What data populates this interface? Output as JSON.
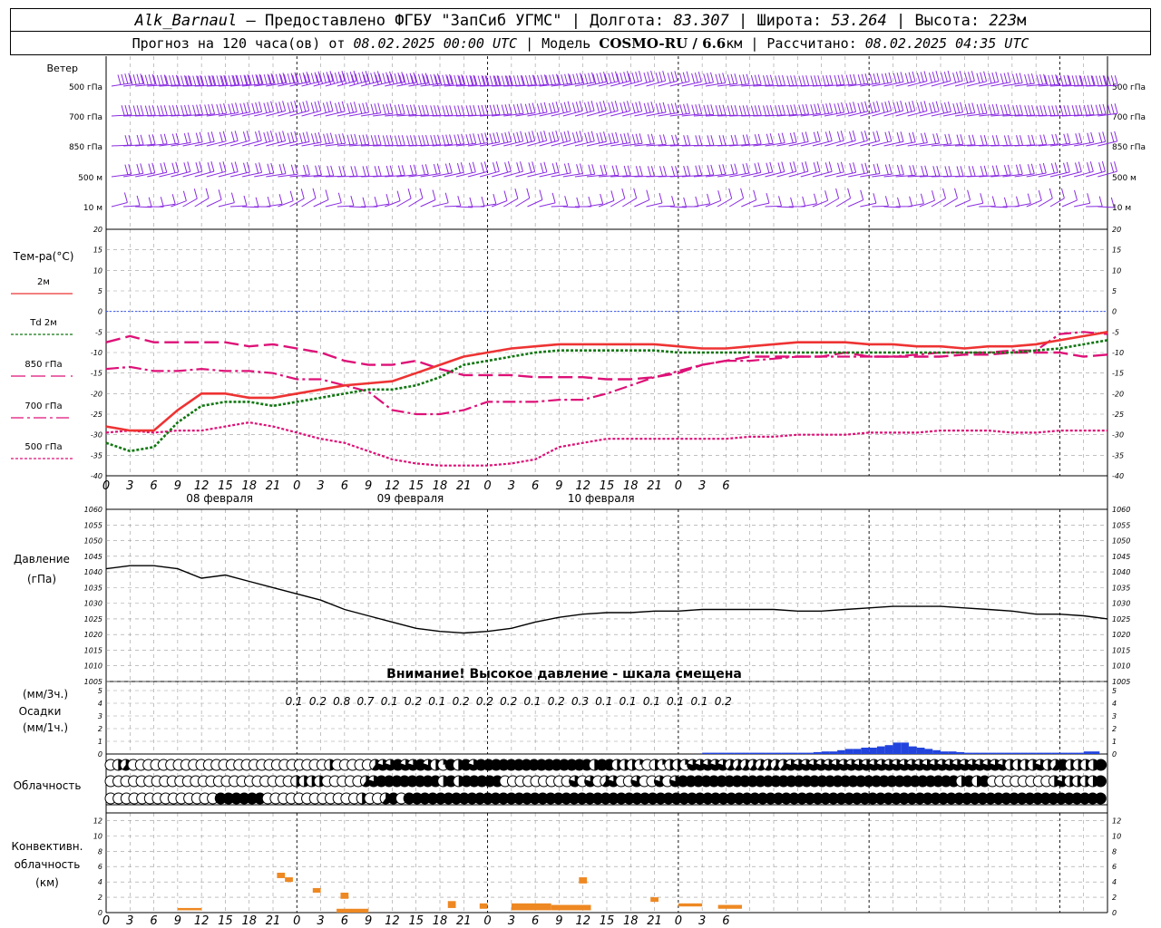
{
  "header": {
    "station": "Alk_Barnaul",
    "provider": " — Предоставлено ФГБУ \"ЗапСиб УГМС\" | Долгота: ",
    "lon": "83.307",
    "lat_label": " | Широта: ",
    "lat": "53.264",
    "alt_label": " | Высота: ",
    "alt": "223",
    "alt_unit": "м",
    "forecast_label": "Прогноз на 120 часа(ов) от ",
    "forecast_start": "08.02.2025 00:00 UTC",
    "model_label": " | Модель ",
    "model": "COSMO-RU / 6.6",
    "model_unit": "км",
    "calc_label": " | Рассчитано: ",
    "calc_time": "08.02.2025 04:35 UTC"
  },
  "labels": {
    "wind_title": "Ветер",
    "temp_title": "Тем-ра(°C)",
    "pressure_title": "Давление",
    "pressure_unit": "(гПа)",
    "pressure_warning": "Внимание! Высокое давление - шкала смещена",
    "precip_3h": "(мм/3ч.)",
    "precip_title": "Осадки",
    "precip_1h": "(мм/1ч.)",
    "cloud_title": "Облачность",
    "conv_line1": "Конвективн.",
    "conv_line2": "облачность",
    "conv_line3": "(км)"
  },
  "colors": {
    "wind": "#8a2be2",
    "t2m": "#ee3333",
    "td2m": "#117711",
    "t850": "#dd1177",
    "t700": "#dd1177",
    "t500": "#dd1177",
    "pressure": "#000000",
    "precip": "#2244dd",
    "conv": "#ee8822",
    "zero": "#3355ff"
  },
  "chart_data": {
    "type": "meteogram",
    "hours_total": 126,
    "x_ticks": [
      "0",
      "3",
      "6",
      "9",
      "12",
      "15",
      "18",
      "21",
      "0",
      "3",
      "6",
      "9",
      "12",
      "15",
      "18",
      "21",
      "0",
      "3",
      "6",
      "9",
      "12",
      "15",
      "18",
      "21",
      "0",
      "3",
      "6"
    ],
    "day_labels": [
      "08 февраля",
      "09 февраля",
      "10 февраля"
    ],
    "wind": {
      "levels": [
        "500 гПа",
        "700 гПа",
        "850 гПа",
        "500 м",
        "10 м"
      ]
    },
    "temperature": {
      "y_ticks": [
        20,
        15,
        10,
        5,
        0,
        -5,
        -10,
        -15,
        -20,
        -25,
        -30,
        -35,
        -40
      ],
      "ylim": [
        -40,
        20
      ],
      "legend": [
        "2м",
        "Td 2м",
        "850 гПа",
        "700 гПа",
        "500 гПа"
      ],
      "hours": [
        0,
        3,
        6,
        9,
        12,
        15,
        18,
        21,
        24,
        27,
        30,
        33,
        36,
        39,
        42,
        45,
        48,
        51,
        54,
        57,
        60,
        63,
        66,
        69,
        72,
        75,
        78,
        81,
        84,
        87,
        90,
        93,
        96,
        99,
        102,
        105,
        108,
        111,
        114,
        117,
        120,
        123,
        126
      ],
      "t2m": [
        -28,
        -29,
        -29,
        -24,
        -20,
        -20,
        -21,
        -21,
        -20,
        -19,
        -18,
        -17.5,
        -17,
        -15,
        -13,
        -11,
        -10,
        -9,
        -8.5,
        -8,
        -8,
        -8,
        -8,
        -8,
        -8.5,
        -9,
        -9,
        -8.5,
        -8,
        -7.5,
        -7.5,
        -7.5,
        -8,
        -8,
        -8.5,
        -8.5,
        -9,
        -8.5,
        -8.5,
        -8,
        -7,
        -6,
        -5
      ],
      "td2m": [
        -32,
        -34,
        -33,
        -27,
        -23,
        -22,
        -22,
        -23,
        -22,
        -21,
        -20,
        -19,
        -19,
        -18,
        -16,
        -13,
        -12,
        -11,
        -10,
        -9.5,
        -9.5,
        -9.5,
        -9.5,
        -9.5,
        -10,
        -10,
        -10,
        -10,
        -10,
        -10,
        -10,
        -10,
        -10,
        -10,
        -10,
        -10,
        -10,
        -10,
        -10,
        -9.5,
        -9,
        -8,
        -7
      ],
      "t850": [
        -7.5,
        -6,
        -7.5,
        -7.5,
        -7.5,
        -7.5,
        -8.5,
        -8,
        -9,
        -10,
        -12,
        -13,
        -13,
        -12,
        -14,
        -15.5,
        -15.5,
        -15.5,
        -16,
        -16,
        -16,
        -16.5,
        -16.5,
        -16,
        -15,
        -13,
        -12,
        -11,
        -11,
        -11,
        -11,
        -10,
        -11,
        -11,
        -11,
        -11,
        -10.5,
        -10.5,
        -10,
        -10,
        -10,
        -11,
        -10.5
      ],
      "t700": [
        -14,
        -13.5,
        -14.5,
        -14.5,
        -14,
        -14.5,
        -14.5,
        -15,
        -16.5,
        -16.5,
        -18,
        -19.5,
        -24,
        -25,
        -25,
        -24,
        -22,
        -22,
        -22,
        -21.5,
        -21.5,
        -20,
        -18,
        -16,
        -14.5,
        -13,
        -12,
        -12,
        -11.5,
        -11,
        -11,
        -11,
        -11,
        -11,
        -10.5,
        -10,
        -10,
        -10,
        -9.5,
        -9.5,
        -5.5,
        -5,
        -5.5
      ],
      "t500": [
        -29.5,
        -29,
        -29.5,
        -29,
        -29,
        -28,
        -27,
        -28,
        -29.5,
        -31,
        -32,
        -34,
        -36,
        -37,
        -37.5,
        -37.5,
        -37.5,
        -37,
        -36,
        -33,
        -32,
        -31,
        -31,
        -31,
        -31,
        -31,
        -31,
        -30.5,
        -30.5,
        -30,
        -30,
        -30,
        -29.5,
        -29.5,
        -29.5,
        -29,
        -29,
        -29,
        -29.5,
        -29.5,
        -29,
        -29,
        -29
      ]
    },
    "pressure": {
      "y_ticks": [
        1060,
        1055,
        1050,
        1045,
        1040,
        1035,
        1030,
        1025,
        1020,
        1015,
        1010,
        1005
      ],
      "ylim": [
        1005,
        1060
      ],
      "hours": [
        0,
        3,
        6,
        9,
        12,
        15,
        18,
        21,
        24,
        27,
        30,
        33,
        36,
        39,
        42,
        45,
        48,
        51,
        54,
        57,
        60,
        63,
        66,
        69,
        72,
        75,
        78,
        81,
        84,
        87,
        90,
        93,
        96,
        99,
        102,
        105,
        108,
        111,
        114,
        117,
        120,
        123,
        126
      ],
      "values": [
        1041,
        1042,
        1042,
        1041,
        1038,
        1039,
        1037,
        1035,
        1033,
        1031,
        1028,
        1026,
        1024,
        1022,
        1021,
        1020.5,
        1021,
        1022,
        1024,
        1025.5,
        1026.5,
        1027,
        1027,
        1027.5,
        1027.5,
        1028,
        1028,
        1028,
        1028,
        1027.5,
        1027.5,
        1028,
        1028.5,
        1029,
        1029,
        1029,
        1028.5,
        1028,
        1027.5,
        1026.5,
        1026.5,
        1026,
        1025
      ]
    },
    "precipitation": {
      "y_ticks": [
        5,
        4,
        3,
        2,
        1,
        0
      ],
      "ylim": [
        0,
        5
      ],
      "totals_3h": [
        "0.1",
        "0.2",
        "0.8",
        "0.7",
        "0.1",
        "0.2",
        "0.1",
        "0.2",
        "0.2",
        "0.2",
        "0.1",
        "0.2",
        "0.3",
        "0.1",
        "0.1",
        "0.1",
        "0.1",
        "0.1",
        "0.2"
      ],
      "totals_start_hour": 72,
      "hourly": [
        0,
        0,
        0,
        0,
        0,
        0,
        0,
        0,
        0,
        0,
        0,
        0,
        0,
        0,
        0,
        0,
        0,
        0,
        0,
        0,
        0,
        0,
        0,
        0,
        0,
        0,
        0,
        0,
        0,
        0,
        0,
        0,
        0,
        0,
        0,
        0,
        0,
        0,
        0,
        0,
        0,
        0,
        0,
        0,
        0,
        0,
        0,
        0,
        0,
        0,
        0,
        0,
        0,
        0,
        0,
        0,
        0,
        0,
        0,
        0,
        0,
        0,
        0,
        0,
        0,
        0,
        0,
        0,
        0,
        0,
        0,
        0,
        0,
        0,
        0,
        0.1,
        0.1,
        0.1,
        0.1,
        0.1,
        0.1,
        0.1,
        0.1,
        0.1,
        0.1,
        0.1,
        0.1,
        0.1,
        0.1,
        0.15,
        0.2,
        0.2,
        0.3,
        0.4,
        0.4,
        0.5,
        0.5,
        0.6,
        0.7,
        0.9,
        0.9,
        0.6,
        0.5,
        0.4,
        0.3,
        0.2,
        0.2,
        0.15,
        0.1,
        0.1,
        0.1,
        0.1,
        0.1,
        0.1,
        0.1,
        0.1,
        0.1,
        0.1,
        0.1,
        0.1,
        0.1,
        0.1,
        0.1,
        0.2,
        0.2
      ]
    },
    "cloudiness": {
      "rows": [
        "high",
        "middle",
        "low"
      ],
      "high": [
        0,
        0.5,
        0.6,
        0,
        0,
        0,
        0,
        0,
        0,
        0,
        0,
        0,
        0,
        0,
        0,
        0,
        0,
        0,
        0,
        0,
        0,
        0,
        0,
        0,
        0,
        0,
        0,
        0,
        0,
        0.5,
        0,
        0,
        0,
        0,
        0,
        0.6,
        0.8,
        0.8,
        1,
        0.8,
        0.8,
        1,
        0.8,
        0.5,
        0.2,
        1,
        0.5,
        1,
        0.8,
        1,
        1,
        1,
        1,
        1,
        1,
        1,
        1,
        1,
        1,
        1,
        1,
        1,
        1,
        1,
        0.5,
        1,
        1,
        0.5,
        0.5,
        0.5,
        0.2,
        0,
        0.5,
        0.2,
        0.5,
        0.5,
        0.2,
        0.8,
        0.8,
        0.8,
        0.8,
        0.8,
        0.6,
        0.6,
        0.6,
        0.6,
        0.6,
        0.6,
        0.6,
        0.6,
        0.8,
        0.8,
        0.8,
        0.8,
        0.8,
        0.8,
        0.8,
        0.8,
        0.8,
        0.8,
        0.8,
        0.8,
        0.8,
        0.8,
        0.8,
        0.8,
        0.8,
        0.8,
        0.8,
        0.8,
        0.8,
        0.8,
        0.8,
        0.8,
        0.8,
        0.8,
        0.8,
        0.8,
        0.8,
        0.5,
        0.5,
        0.5,
        0.5,
        0.8,
        0.5,
        0.6,
        1,
        0.5,
        0.5,
        0.5,
        0.5,
        1
      ],
      "middle": [
        0,
        0,
        0,
        0,
        0,
        0,
        0,
        0,
        0,
        0,
        0,
        0,
        0,
        0,
        0,
        0,
        0,
        0,
        0,
        0,
        0,
        0,
        0,
        0,
        0.5,
        0.5,
        0.5,
        0.5,
        0,
        0,
        0,
        0,
        0,
        0.6,
        0.8,
        1,
        1,
        1,
        1,
        1,
        1,
        1,
        1,
        0.5,
        1,
        0.5,
        1,
        1,
        1,
        1,
        1,
        0,
        0,
        0,
        0,
        0,
        0,
        0,
        0,
        0,
        0.8,
        0,
        0.8,
        0,
        0.6,
        0.8,
        0,
        0,
        0.8,
        0,
        0,
        0.8,
        0,
        0.8,
        1,
        1,
        1,
        1,
        1,
        1,
        1,
        1,
        1,
        1,
        1,
        1,
        1,
        1,
        1,
        1,
        1,
        1,
        1,
        1,
        1,
        1,
        1,
        1,
        1,
        1,
        1,
        1,
        1,
        1,
        1,
        1,
        1,
        1,
        1,
        1,
        0.5,
        1,
        0.5,
        1,
        0,
        0,
        0,
        0,
        0,
        0,
        0,
        0,
        0.5,
        0.8,
        0.5,
        0.5,
        0.5,
        0.5,
        1
      ],
      "low": [
        0,
        0,
        0,
        0,
        0,
        0,
        0,
        0,
        0,
        0,
        0,
        0,
        0,
        0,
        1,
        1,
        1,
        1,
        1,
        1,
        0,
        0,
        0,
        0,
        0,
        0,
        0,
        0,
        0,
        0,
        0,
        0,
        0.5,
        0,
        0,
        0.6,
        1,
        0,
        1,
        1,
        1,
        1,
        1,
        1,
        1,
        1,
        1,
        1,
        1,
        1,
        1,
        1,
        1,
        1,
        1,
        1,
        1,
        1,
        1,
        1,
        1,
        1,
        1,
        1,
        1,
        1,
        1,
        1,
        1,
        1,
        1,
        1,
        1,
        1,
        1,
        1,
        1,
        1,
        1,
        1,
        1,
        1,
        1,
        1,
        1,
        1,
        1,
        1,
        1,
        1,
        1,
        1,
        1,
        1,
        1,
        1,
        1,
        1,
        1,
        1,
        1,
        1,
        1,
        1,
        1,
        1,
        1,
        1,
        1,
        1,
        1,
        1,
        1,
        1,
        1,
        1,
        1,
        1,
        1,
        1,
        1,
        1,
        1,
        1,
        1,
        1,
        1
      ]
    },
    "convective": {
      "y_ticks": [
        12,
        10,
        8,
        6,
        4,
        2,
        0
      ],
      "ylim": [
        0,
        13
      ],
      "segments": [
        {
          "h0": 9,
          "h1": 12,
          "lo": 0.3,
          "hi": 0.6
        },
        {
          "h0": 21.5,
          "h1": 22.5,
          "lo": 4.5,
          "hi": 5.2
        },
        {
          "h0": 22.5,
          "h1": 23.5,
          "lo": 4.0,
          "hi": 4.6
        },
        {
          "h0": 26,
          "h1": 27,
          "lo": 2.6,
          "hi": 3.2
        },
        {
          "h0": 29.5,
          "h1": 30.5,
          "lo": 1.8,
          "hi": 2.6
        },
        {
          "h0": 29,
          "h1": 33,
          "lo": 0,
          "hi": 0.5
        },
        {
          "h0": 43,
          "h1": 44,
          "lo": 0.6,
          "hi": 1.5
        },
        {
          "h0": 47,
          "h1": 48,
          "lo": 0.5,
          "hi": 1.2
        },
        {
          "h0": 51,
          "h1": 56,
          "lo": 0.3,
          "hi": 1.2
        },
        {
          "h0": 56,
          "h1": 61,
          "lo": 0.3,
          "hi": 1.0
        },
        {
          "h0": 59.5,
          "h1": 60.5,
          "lo": 3.8,
          "hi": 4.6
        },
        {
          "h0": 68.5,
          "h1": 69.5,
          "lo": 1.4,
          "hi": 2.0
        },
        {
          "h0": 72,
          "h1": 75,
          "lo": 0.8,
          "hi": 1.2
        },
        {
          "h0": 77,
          "h1": 80,
          "lo": 0.5,
          "hi": 1.0
        }
      ]
    }
  }
}
